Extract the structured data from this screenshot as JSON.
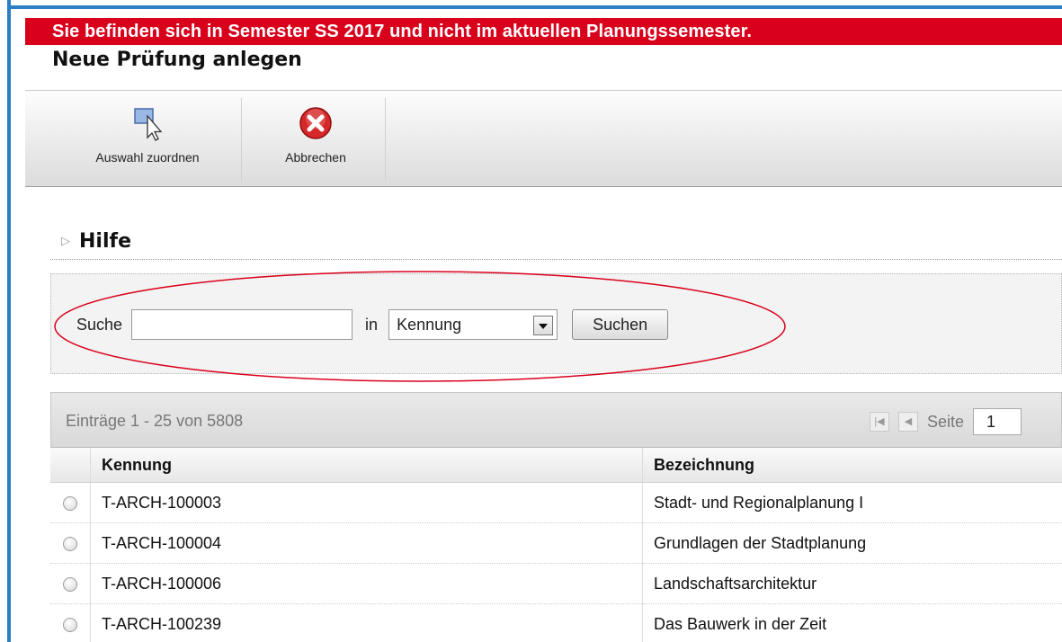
{
  "banner": {
    "text": "Sie befinden sich in Semester SS 2017 und nicht im aktuellen Planungssemester."
  },
  "page": {
    "title": "Neue Prüfung anlegen"
  },
  "toolbar": {
    "assign_label": "Auswahl zuordnen",
    "cancel_label": "Abbrechen"
  },
  "help": {
    "label": "Hilfe"
  },
  "search": {
    "label": "Suche",
    "value": "",
    "in_label": "in",
    "field_selected": "Kennung",
    "button_label": "Suchen"
  },
  "grid": {
    "count_label": "Einträge 1 - 25 von 5808",
    "page_label": "Seite",
    "page_value": "1",
    "columns": [
      "Kennung",
      "Bezeichnung"
    ],
    "rows": [
      {
        "kennung": "T-ARCH-100003",
        "bezeichnung": "Stadt- und Regionalplanung I"
      },
      {
        "kennung": "T-ARCH-100004",
        "bezeichnung": "Grundlagen der Stadtplanung"
      },
      {
        "kennung": "T-ARCH-100006",
        "bezeichnung": "Landschaftsarchitektur"
      },
      {
        "kennung": "T-ARCH-100239",
        "bezeichnung": "Das Bauwerk in der Zeit"
      }
    ]
  },
  "colors": {
    "banner": "#d9001b",
    "frame": "#2c7fc4",
    "highlight_ellipse": "#d9001b"
  },
  "icons": {
    "assign": "cursor-select-icon",
    "cancel": "red-x-circle-icon"
  }
}
